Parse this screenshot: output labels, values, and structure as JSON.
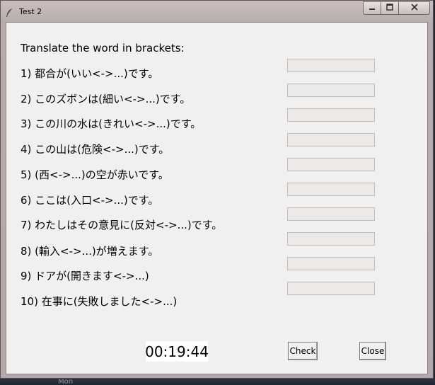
{
  "window": {
    "title": "Test 2",
    "app_icon": "feather-icon",
    "controls": {
      "minimize": "minimize-icon",
      "maximize": "maximize-icon",
      "close": "close-x-icon"
    }
  },
  "instruction": "Translate the word in brackets:",
  "questions": [
    {
      "label": "1) 都合が(いい<->...)です。",
      "answer": ""
    },
    {
      "label": "2) このズボンは(細い<->...)です。",
      "answer": ""
    },
    {
      "label": "3) この川の水は(きれい<->...)です。",
      "answer": ""
    },
    {
      "label": "4) この山は(危険<->...)です。",
      "answer": ""
    },
    {
      "label": "5) (西<->...)の空が赤いです。",
      "answer": ""
    },
    {
      "label": "6) ここは(入口<->...)です。",
      "answer": ""
    },
    {
      "label": "7) わたしはその意見に(反対<->...)です。",
      "answer": ""
    },
    {
      "label": "8) (輸入<->...)が増えます。",
      "answer": ""
    },
    {
      "label": "9) ドアが(開きます<->...)",
      "answer": ""
    },
    {
      "label": "10) 在事に(失敗しました<->...)"
    }
  ],
  "timer": "00:19:44",
  "buttons": {
    "check": "Check",
    "close": "Close"
  },
  "background": {
    "partial_text": "Mon"
  }
}
